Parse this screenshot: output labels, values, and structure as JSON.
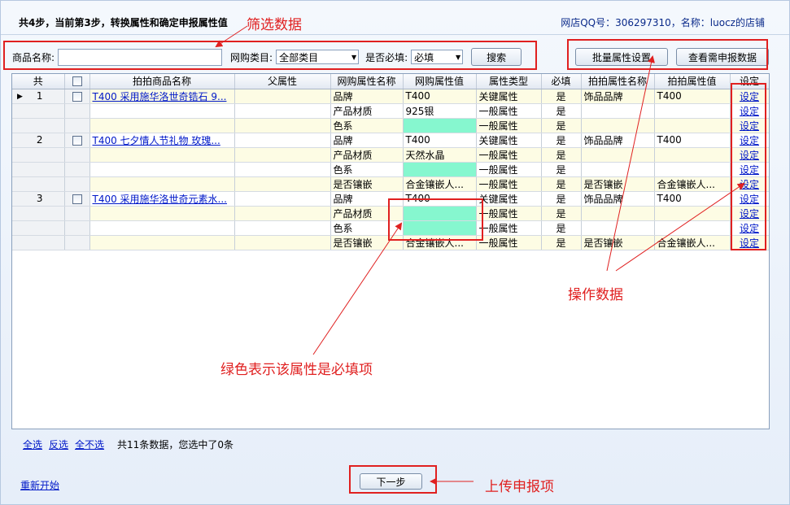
{
  "header": {
    "step_title": "共4步，当前第3步，转换属性和确定申报属性值",
    "shop_info": "网店QQ号：306297310，名称：luocz的店铺"
  },
  "filter": {
    "name_label": "商品名称:",
    "name_value": "",
    "category_label": "网购类目:",
    "category_value": "全部类目",
    "required_label": "是否必填:",
    "required_value": "必填",
    "search_label": "搜索"
  },
  "actions": {
    "batch_label": "批量属性设置",
    "view_label": "查看需申报数据"
  },
  "table": {
    "headers": [
      "共",
      "",
      "拍拍商品名称",
      "父属性",
      "网购属性名称",
      "网购属性值",
      "属性类型",
      "必填",
      "拍拍属性名称",
      "拍拍属性值",
      "设定"
    ],
    "rows": [
      {
        "num": "1",
        "check": true,
        "name": "T400 采用施华洛世奇锆石 9...",
        "parent": "",
        "attr": "品牌",
        "value": "T400",
        "type": "关键属性",
        "req": "是",
        "pp_attr": "饰品品牌",
        "pp_value": "T400",
        "action": "设定",
        "green": false,
        "pointer": true
      },
      {
        "num": "",
        "check": false,
        "name": "",
        "parent": "",
        "attr": "产品材质",
        "value": "925银",
        "type": "一般属性",
        "req": "是",
        "pp_attr": "",
        "pp_value": "",
        "action": "设定",
        "green": false
      },
      {
        "num": "",
        "check": false,
        "name": "",
        "parent": "",
        "attr": "色系",
        "value": "",
        "type": "一般属性",
        "req": "是",
        "pp_attr": "",
        "pp_value": "",
        "action": "设定",
        "green": true
      },
      {
        "num": "2",
        "check": true,
        "name": "T400 七夕情人节礼物 玫瑰...",
        "parent": "",
        "attr": "品牌",
        "value": "T400",
        "type": "关键属性",
        "req": "是",
        "pp_attr": "饰品品牌",
        "pp_value": "T400",
        "action": "设定",
        "green": false
      },
      {
        "num": "",
        "check": false,
        "name": "",
        "parent": "",
        "attr": "产品材质",
        "value": "天然水晶",
        "type": "一般属性",
        "req": "是",
        "pp_attr": "",
        "pp_value": "",
        "action": "设定",
        "green": false
      },
      {
        "num": "",
        "check": false,
        "name": "",
        "parent": "",
        "attr": "色系",
        "value": "",
        "type": "一般属性",
        "req": "是",
        "pp_attr": "",
        "pp_value": "",
        "action": "设定",
        "green": true
      },
      {
        "num": "",
        "check": false,
        "name": "",
        "parent": "",
        "attr": "是否镶嵌",
        "value": "合金镶嵌人...",
        "type": "一般属性",
        "req": "是",
        "pp_attr": "是否镶嵌",
        "pp_value": "合金镶嵌人...",
        "action": "设定",
        "green": false
      },
      {
        "num": "3",
        "check": true,
        "name": "T400 采用施华洛世奇元素水...",
        "parent": "",
        "attr": "品牌",
        "value": "T400",
        "type": "关键属性",
        "req": "是",
        "pp_attr": "饰品品牌",
        "pp_value": "T400",
        "action": "设定",
        "green": false
      },
      {
        "num": "",
        "check": false,
        "name": "",
        "parent": "",
        "attr": "产品材质",
        "value": "",
        "type": "一般属性",
        "req": "是",
        "pp_attr": "",
        "pp_value": "",
        "action": "设定",
        "green": true
      },
      {
        "num": "",
        "check": false,
        "name": "",
        "parent": "",
        "attr": "色系",
        "value": "",
        "type": "一般属性",
        "req": "是",
        "pp_attr": "",
        "pp_value": "",
        "action": "设定",
        "green": true
      },
      {
        "num": "",
        "check": false,
        "name": "",
        "parent": "",
        "attr": "是否镶嵌",
        "value": "合金镶嵌人...",
        "type": "一般属性",
        "req": "是",
        "pp_attr": "是否镶嵌",
        "pp_value": "合金镶嵌人...",
        "action": "设定",
        "green": false
      }
    ]
  },
  "footer": {
    "select_all": "全选",
    "invert": "反选",
    "select_none": "全不选",
    "count_text": "共11条数据，您选中了0条",
    "restart": "重新开始",
    "next": "下一步"
  },
  "annotations": {
    "filter": "筛选数据",
    "operate": "操作数据",
    "green_note": "绿色表示该属性是必填项",
    "upload": "上传申报项"
  },
  "colors": {
    "annotation": "#e02020",
    "required_green": "#86f7cf",
    "link": "#0018c8"
  }
}
